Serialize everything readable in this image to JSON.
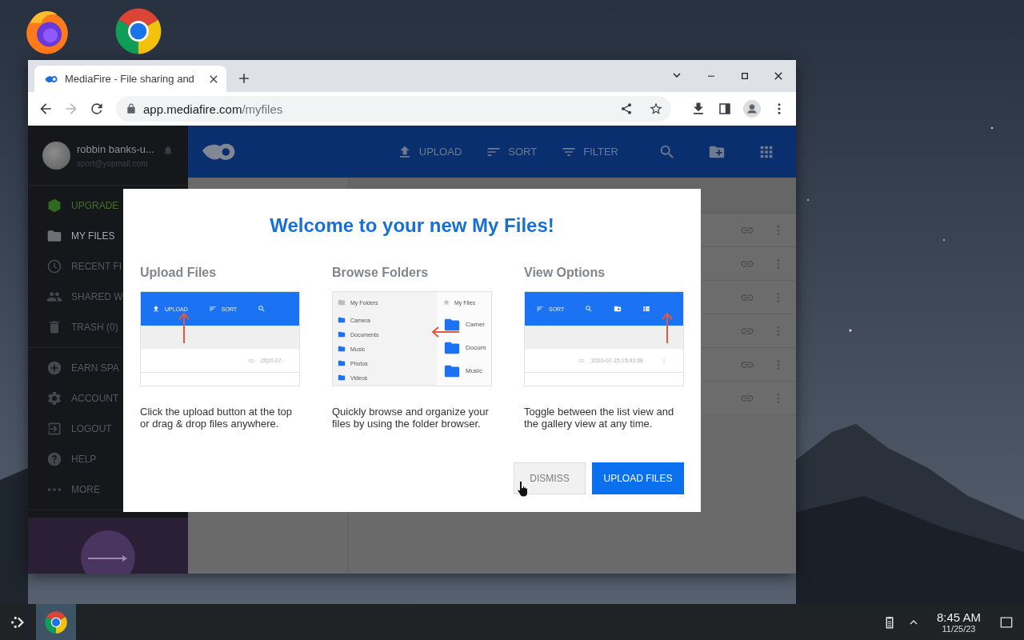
{
  "desktop_icons": [
    {
      "kind": "firefox"
    },
    {
      "kind": "chrome"
    }
  ],
  "browser": {
    "tabs": [
      {
        "title": "MediaFire - File sharing and",
        "selected": true
      }
    ],
    "back_disabled": false,
    "forward_disabled": true,
    "url_host": "app.mediafire.com",
    "url_path": "/myfiles"
  },
  "sidebar": {
    "user": {
      "name": "robbin banks-u...",
      "email": "sport@yopmail.com"
    },
    "sections": [
      {
        "items": [
          {
            "kind": "promo",
            "label": "UPGRADE",
            "selected": false
          },
          {
            "kind": "nav",
            "label": "MY FILES",
            "selected": true
          },
          {
            "kind": "nav",
            "label": "RECENT FI",
            "selected": false
          },
          {
            "kind": "nav",
            "label": "SHARED W",
            "selected": false
          },
          {
            "kind": "nav",
            "label": "TRASH (0)",
            "selected": false
          }
        ]
      },
      {
        "items": [
          {
            "kind": "nav",
            "label": "EARN SPA",
            "selected": false
          },
          {
            "kind": "nav",
            "label": "ACCOUNT",
            "selected": false
          },
          {
            "kind": "nav",
            "label": "LOGOUT",
            "selected": false
          },
          {
            "kind": "nav",
            "label": "HELP",
            "selected": false
          },
          {
            "kind": "nav",
            "label": "MORE",
            "selected": false
          }
        ]
      }
    ]
  },
  "header": {
    "actions": [
      {
        "label": "UPLOAD"
      },
      {
        "label": "SORT"
      },
      {
        "label": "FILTER"
      }
    ]
  },
  "file_list": {
    "rows": [
      {
        "kind": "file"
      },
      {
        "kind": "file"
      },
      {
        "kind": "file"
      },
      {
        "kind": "file"
      },
      {
        "kind": "file"
      },
      {
        "kind": "file"
      }
    ]
  },
  "modal": {
    "title": "Welcome to your new My Files!",
    "features": [
      {
        "heading": "Upload Files",
        "description": "Click the upload button at the top or drag & drop files anywhere.",
        "illustration": {
          "kind": "upload",
          "upload_label": "UPLOAD",
          "sort_label": "SORT",
          "dates": [
            "2020-07-"
          ]
        }
      },
      {
        "heading": "Browse Folders",
        "description": "Quickly browse and organize your files by using the folder browser.",
        "illustration": {
          "kind": "folders",
          "tree_title": "My Folders",
          "tree": [
            "Camera",
            "Documents",
            "Music",
            "Photos",
            "Videos"
          ],
          "pane_title": "My Files",
          "pane": [
            "Camer",
            "Docum",
            "Music"
          ]
        }
      },
      {
        "heading": "View Options",
        "description": "Toggle between the list view and the gallery view at any time.",
        "illustration": {
          "kind": "view",
          "sort_label": "SORT",
          "dates": [
            "2020-07-15 15:41:08"
          ]
        }
      }
    ],
    "buttons": [
      {
        "kind": "secondary",
        "label": "DISMISS"
      },
      {
        "kind": "primary",
        "label": "UPLOAD FILES"
      }
    ]
  },
  "taskbar": {
    "apps": [
      {
        "kind": "chrome",
        "selected": true
      }
    ],
    "time": "8:45 AM",
    "date": "11/25/23"
  }
}
